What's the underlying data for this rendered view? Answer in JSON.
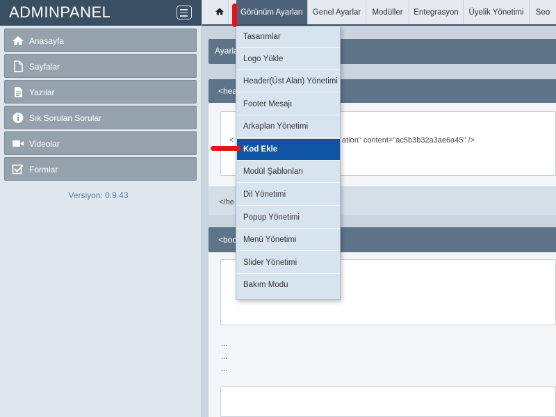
{
  "app": {
    "title": "ADMINPANEL"
  },
  "sidebar": {
    "items": [
      {
        "label": "Anasayfa",
        "icon": "home-icon"
      },
      {
        "label": "Sayfalar",
        "icon": "document-icon"
      },
      {
        "label": "Yazılar",
        "icon": "text-file-icon"
      },
      {
        "label": "Sık Sorulan Sorular",
        "icon": "info-icon"
      },
      {
        "label": "Videolar",
        "icon": "video-camera-icon"
      },
      {
        "label": "Formlar",
        "icon": "checkbox-icon"
      }
    ],
    "version": "Versiyon: 0.9.43"
  },
  "topbar": {
    "tabs": [
      {
        "label": "Görünüm Ayarları"
      },
      {
        "label": "Genel Ayarlar"
      },
      {
        "label": "Modüller"
      },
      {
        "label": "Entegrasyon"
      },
      {
        "label": "Üyelik Yönetimi"
      },
      {
        "label": "Seo"
      }
    ]
  },
  "dropdown": {
    "items": [
      "Tasarımlar",
      "Logo Yükle",
      "Header(Üst Alan) Yönetimi",
      "Footer Mesajı",
      "Arkaplan Yönetimi",
      "Kod Ekle",
      "Modül Şablonları",
      "Dil Yönetimi",
      "Popup Yönetimi",
      "Menü Yönetimi",
      "Slider Yönetimi",
      "Bakım Modu"
    ],
    "selected": "Kod Ekle"
  },
  "content": {
    "section_title": "Ayarla",
    "head_panel_title": "<hea",
    "head_code_left": "<",
    "head_code_right": "ation\" content=\"ac5b3b32a3ae6a45\" />",
    "head_close": "</he",
    "body_panel_title": "<boc",
    "ellipsis": [
      "...",
      "...",
      "..."
    ]
  },
  "colors": {
    "brand_bar": "#3b4f63",
    "active_tab": "#4d6278",
    "selected_item": "#0f55a3",
    "annotation_red": "#e8111b"
  }
}
